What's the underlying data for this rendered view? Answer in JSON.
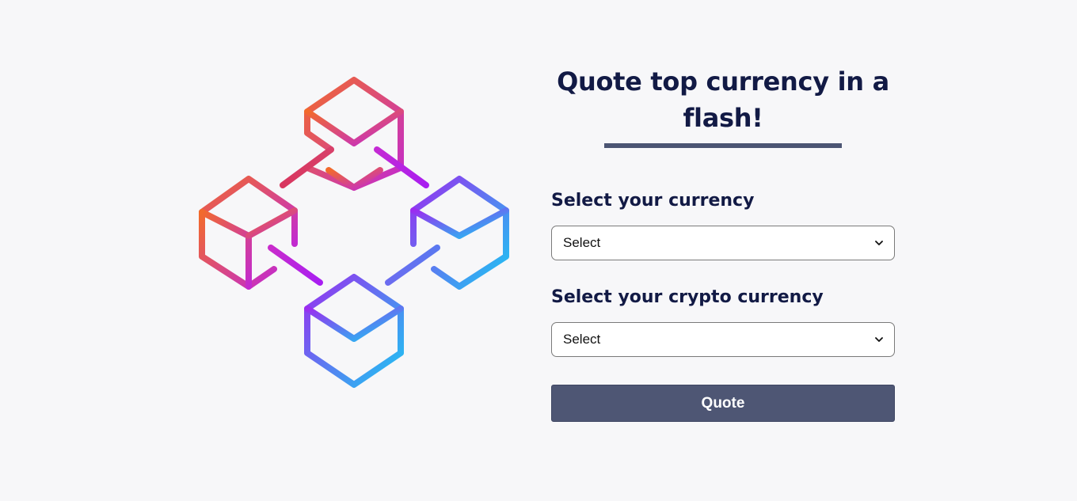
{
  "main": {
    "title": "Quote top currency in a flash!",
    "currency_label": "Select your currency",
    "currency_select_value": "Select",
    "crypto_label": "Select your crypto currency",
    "crypto_select_value": "Select",
    "quote_button_label": "Quote"
  },
  "colors": {
    "background": "#f7f7f9",
    "heading": "#121a45",
    "accent": "#4e5674",
    "gradient_warm_start": "#f26a2c",
    "gradient_warm_end": "#c22ad0",
    "gradient_cool_start": "#9b2cf0",
    "gradient_cool_end": "#1cc8f2"
  },
  "icons": {
    "illustration": "blockchain-cubes-icon",
    "select_arrow": "chevron-down-icon"
  }
}
